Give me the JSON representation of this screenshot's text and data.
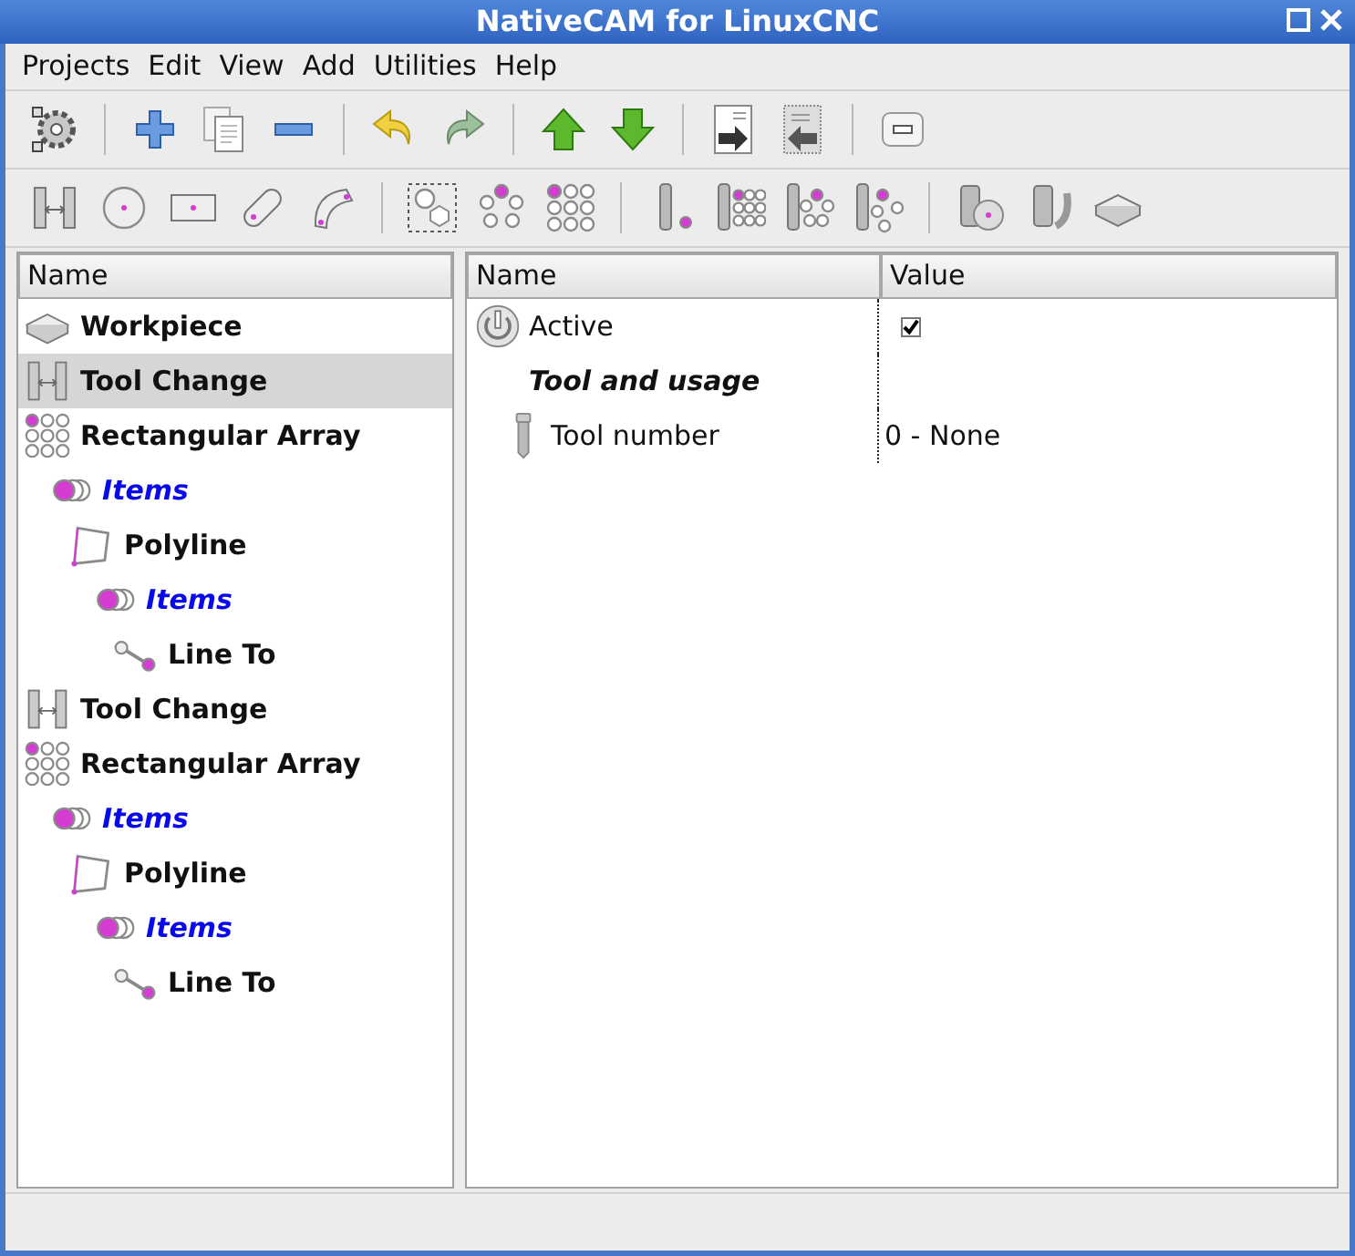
{
  "window": {
    "title": "NativeCAM for LinuxCNC"
  },
  "menu": [
    "Projects",
    "Edit",
    "View",
    "Add",
    "Utilities",
    "Help"
  ],
  "toolbars": [
    [
      {
        "kind": "button"
      },
      {
        "kind": "separator"
      },
      {
        "kind": "button"
      },
      {
        "kind": "button"
      },
      {
        "kind": "button"
      },
      {
        "kind": "separator"
      },
      {
        "kind": "button"
      },
      {
        "kind": "button"
      },
      {
        "kind": "separator"
      },
      {
        "kind": "button"
      },
      {
        "kind": "button"
      },
      {
        "kind": "separator"
      },
      {
        "kind": "button"
      },
      {
        "kind": "button"
      },
      {
        "kind": "separator"
      },
      {
        "kind": "button"
      }
    ],
    [
      {
        "kind": "button"
      },
      {
        "kind": "button"
      },
      {
        "kind": "button"
      },
      {
        "kind": "button"
      },
      {
        "kind": "button"
      },
      {
        "kind": "separator"
      },
      {
        "kind": "button"
      },
      {
        "kind": "button"
      },
      {
        "kind": "button"
      },
      {
        "kind": "separator"
      },
      {
        "kind": "button"
      },
      {
        "kind": "button"
      },
      {
        "kind": "button"
      },
      {
        "kind": "button"
      },
      {
        "kind": "separator"
      },
      {
        "kind": "button"
      },
      {
        "kind": "button"
      },
      {
        "kind": "button"
      }
    ]
  ],
  "tree": {
    "column": "Name",
    "nodes": [
      {
        "label": "Workpiece",
        "kind": "workpiece",
        "selected": false
      },
      {
        "label": "Tool Change",
        "kind": "tool-change",
        "selected": true
      },
      {
        "label": "Rectangular Array",
        "kind": "rect-array",
        "selected": false,
        "children": [
          {
            "label": "Items",
            "kind": "items",
            "selected": false,
            "children": [
              {
                "label": "Polyline",
                "kind": "polyline",
                "selected": false,
                "children": [
                  {
                    "label": "Items",
                    "kind": "items",
                    "selected": false,
                    "children": [
                      {
                        "label": "Line To",
                        "kind": "line-to",
                        "selected": false
                      }
                    ]
                  }
                ]
              }
            ]
          }
        ]
      },
      {
        "label": "Tool Change",
        "kind": "tool-change",
        "selected": false
      },
      {
        "label": "Rectangular Array",
        "kind": "rect-array",
        "selected": false,
        "children": [
          {
            "label": "Items",
            "kind": "items",
            "selected": false,
            "children": [
              {
                "label": "Polyline",
                "kind": "polyline",
                "selected": false,
                "children": [
                  {
                    "label": "Items",
                    "kind": "items",
                    "selected": false,
                    "children": [
                      {
                        "label": "Line To",
                        "kind": "line-to",
                        "selected": false
                      }
                    ]
                  }
                ]
              }
            ]
          }
        ]
      }
    ]
  },
  "properties": {
    "columns": [
      "Name",
      "Value"
    ],
    "rows": [
      {
        "kind": "checkbox",
        "name": "Active",
        "checked": true
      },
      {
        "kind": "header",
        "name": "Tool and usage"
      },
      {
        "kind": "value",
        "name": "Tool number",
        "value": "0 - None"
      }
    ]
  }
}
